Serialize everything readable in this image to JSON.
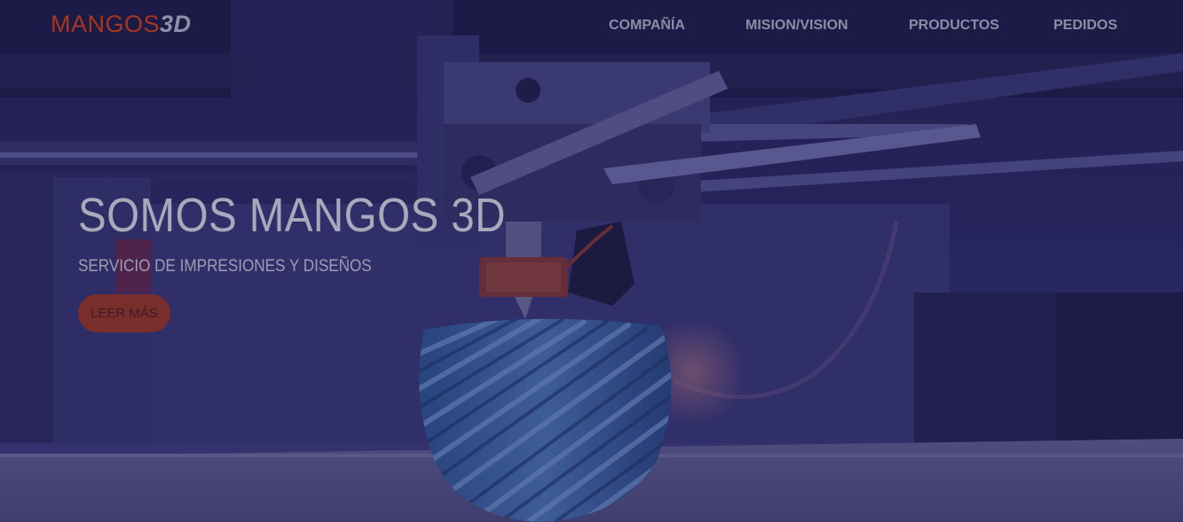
{
  "brand": {
    "name_part1": "MANGOS",
    "name_part2": "3D",
    "color_primary": "#a8361f"
  },
  "nav": {
    "items": [
      {
        "label": "COMPAÑÍA"
      },
      {
        "label": "MISION/VISION"
      },
      {
        "label": "PRODUCTOS"
      },
      {
        "label": "PEDIDOS"
      }
    ]
  },
  "hero": {
    "title": "SOMOS MANGOS 3D",
    "subtitle": "SERVICIO DE IMPRESIONES Y DISEÑOS",
    "cta_label": "LEER MÁS",
    "background_image": "3d-printer-printing-blue-spiral-vase"
  },
  "colors": {
    "overlay": "#1c1850",
    "accent": "#7a2e2c"
  }
}
